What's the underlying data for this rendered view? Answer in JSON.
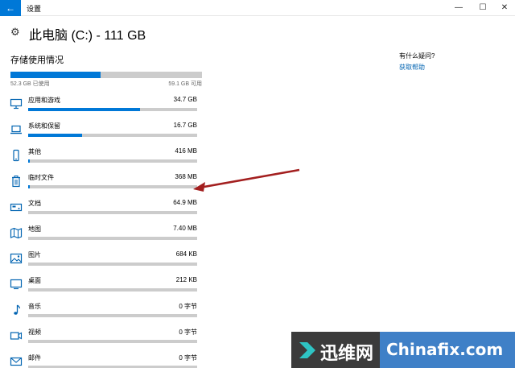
{
  "window": {
    "app_title": "设置",
    "back_glyph": "←",
    "min_glyph": "—",
    "max_glyph": "☐",
    "close_glyph": "✕"
  },
  "header": {
    "title": "此电脑 (C:) - 111 GB",
    "icon": "gear-icon"
  },
  "storage": {
    "section_title": "存储使用情况",
    "used_label": "52.3 GB 已使用",
    "free_label": "59.1 GB 可用",
    "used_fraction": 0.47
  },
  "items": [
    {
      "label": "应用和游戏",
      "size": "34.7 GB",
      "fill": 0.66,
      "icon": "monitor-icon"
    },
    {
      "label": "系统和保留",
      "size": "16.7 GB",
      "fill": 0.32,
      "icon": "laptop-icon"
    },
    {
      "label": "其他",
      "size": "416 MB",
      "fill": 0.008,
      "icon": "phone-icon"
    },
    {
      "label": "临时文件",
      "size": "368 MB",
      "fill": 0.007,
      "icon": "trash-icon"
    },
    {
      "label": "文档",
      "size": "64.9 MB",
      "fill": 0.0,
      "icon": "drive-icon"
    },
    {
      "label": "地图",
      "size": "7.40 MB",
      "fill": 0.0,
      "icon": "map-icon"
    },
    {
      "label": "图片",
      "size": "684 KB",
      "fill": 0.0,
      "icon": "picture-icon"
    },
    {
      "label": "桌面",
      "size": "212 KB",
      "fill": 0.0,
      "icon": "desktop-icon"
    },
    {
      "label": "音乐",
      "size": "0 字节",
      "fill": 0.0,
      "icon": "music-icon"
    },
    {
      "label": "视频",
      "size": "0 字节",
      "fill": 0.0,
      "icon": "video-icon"
    },
    {
      "label": "邮件",
      "size": "0 字节",
      "fill": 0.0,
      "icon": "mail-icon"
    }
  ],
  "help": {
    "title": "有什么疑问?",
    "link": "获取帮助"
  },
  "watermark": {
    "cn": "迅维网",
    "en": "Chinafix.com"
  },
  "colors": {
    "accent": "#0078d7",
    "bar_bg": "#cccccc",
    "arrow": "#a31f1f",
    "link": "#0063b1"
  }
}
